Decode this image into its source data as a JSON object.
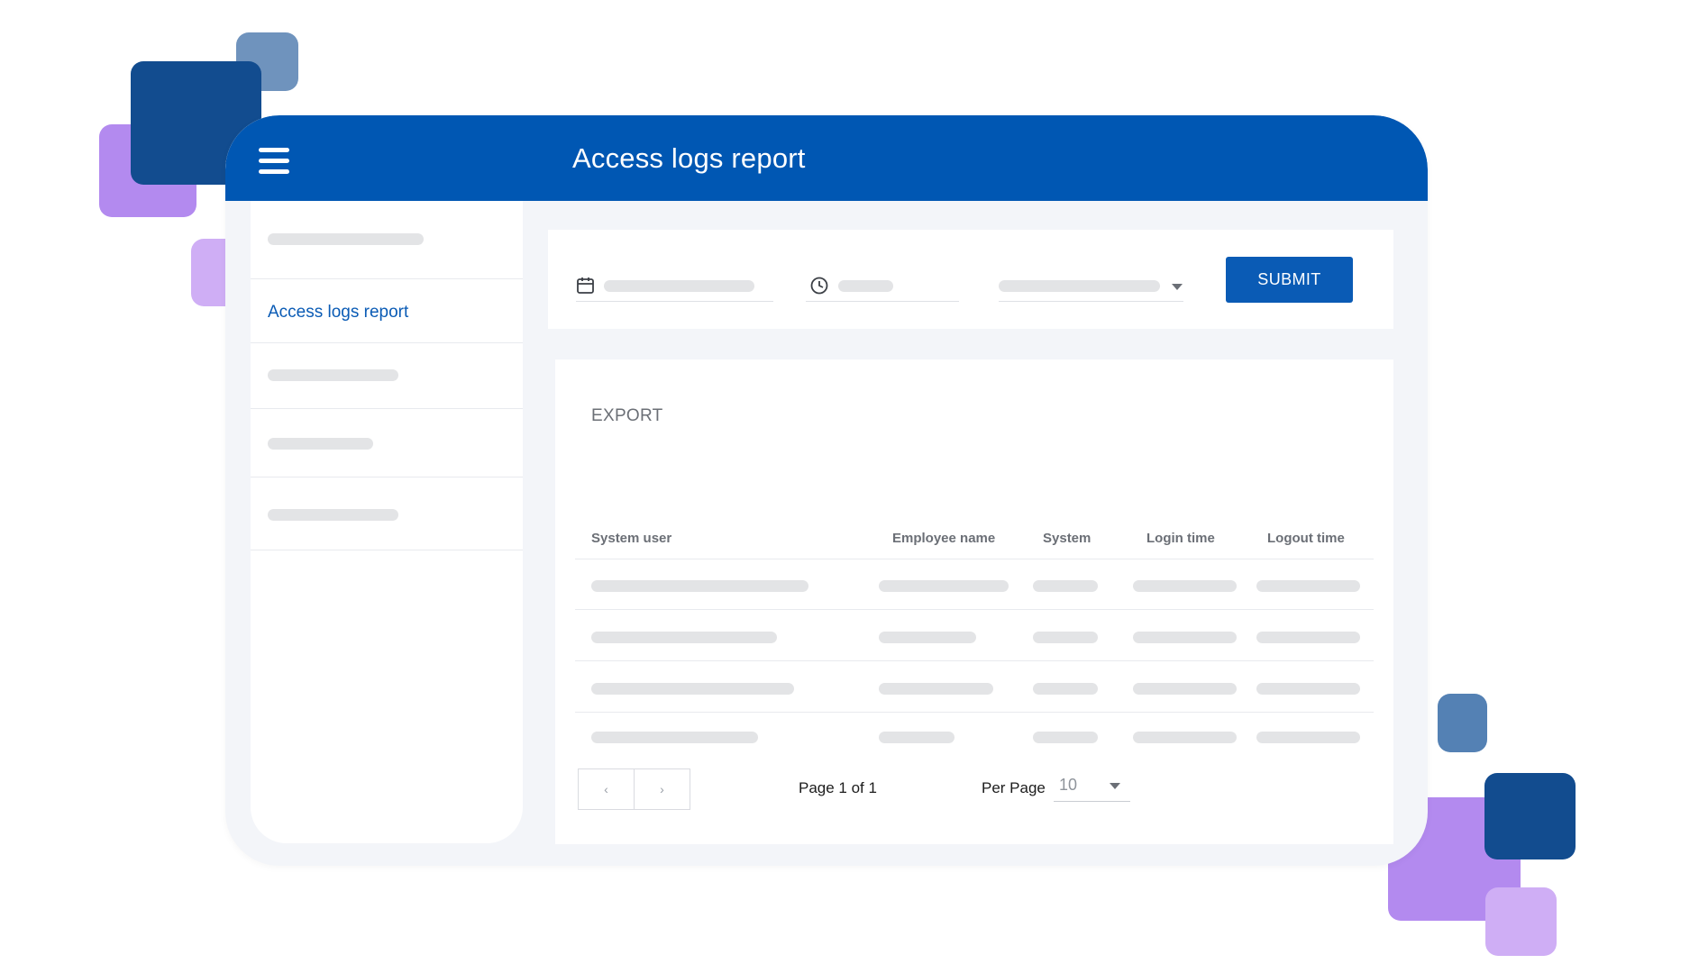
{
  "app": {
    "title": "Access logs report"
  },
  "sidebar": {
    "active_item": "Access logs report"
  },
  "filters": {
    "submit_label": "SUBMIT"
  },
  "table": {
    "export_label": "EXPORT",
    "columns": [
      "System user",
      "Employee name",
      "System",
      "Login time",
      "Logout time"
    ]
  },
  "pagination": {
    "prev_symbol": "‹",
    "next_symbol": "›",
    "page_info": "Page 1 of 1",
    "per_page_label": "Per Page",
    "per_page_value": "10"
  },
  "icons": [
    "menu-icon",
    "calendar-icon",
    "clock-icon",
    "chevron-down-icon",
    "chevron-left-icon",
    "chevron-right-icon"
  ],
  "colors": {
    "primary": "#0057b3",
    "accent_button": "#0a5bb5",
    "deco_dark_blue": "#124c8f",
    "deco_steel_blue": "#6f93bd",
    "deco_purple": "#b38aef",
    "deco_light_purple": "#cfaef5",
    "background_panel": "#f3f5f9",
    "placeholder_gray": "#e3e4e6"
  }
}
